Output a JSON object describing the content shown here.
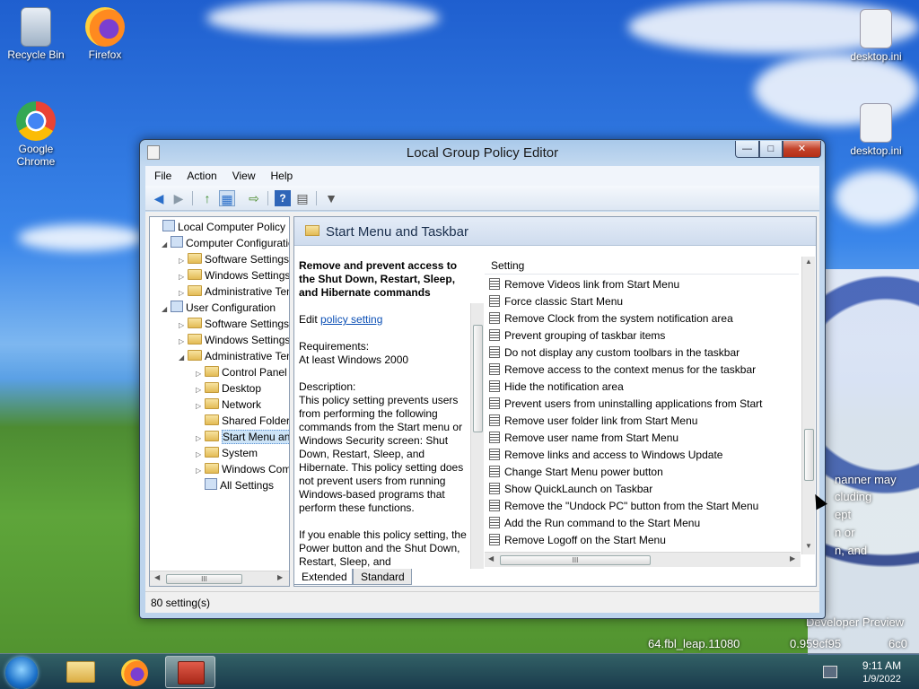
{
  "desktop": {
    "icons": [
      {
        "label": "Recycle Bin",
        "icon": "recycle-bin-icon"
      },
      {
        "label": "Firefox",
        "icon": "firefox-icon"
      },
      {
        "label": "Google Chrome",
        "icon": "chrome-icon"
      },
      {
        "label": "desktop.ini",
        "icon": "ini-file-icon"
      },
      {
        "label": "desktop.ini",
        "icon": "ini-file-icon"
      }
    ],
    "bg_fragments": [
      "nanner may",
      "cluding",
      "ept",
      "n or",
      "n, and",
      "Developer Preview",
      "64.fbl_leap.11080",
      "0.959cf95",
      "6c0"
    ]
  },
  "window": {
    "title": "Local Group Policy Editor",
    "controls": {
      "minimize": "—",
      "maximize": "□",
      "close": "✕"
    }
  },
  "menu": [
    "File",
    "Action",
    "View",
    "Help"
  ],
  "toolbar": {
    "icons": [
      "back-arrow-icon",
      "forward-arrow-icon",
      "up-folder-icon",
      "show-hide-tree-icon",
      "export-list-icon",
      "help-icon",
      "properties-icon",
      "filter-icon"
    ],
    "glyphs": {
      "back": "◀",
      "forward": "▶",
      "up": "↑",
      "tree": "▦",
      "export": "⇨",
      "help": "?",
      "props": "▤",
      "filter": "▼"
    }
  },
  "tree": {
    "items": [
      {
        "label": "Local Computer Policy",
        "level": 0,
        "exp": "",
        "type": "policy"
      },
      {
        "label": "Computer Configuration",
        "level": 1,
        "exp": "◢",
        "type": "pc"
      },
      {
        "label": "Software Settings",
        "level": 2,
        "exp": "▷",
        "type": "folder"
      },
      {
        "label": "Windows Settings",
        "level": 2,
        "exp": "▷",
        "type": "folder"
      },
      {
        "label": "Administrative Templates",
        "level": 2,
        "exp": "▷",
        "type": "folder"
      },
      {
        "label": "User Configuration",
        "level": 1,
        "exp": "◢",
        "type": "user"
      },
      {
        "label": "Software Settings",
        "level": 2,
        "exp": "▷",
        "type": "folder"
      },
      {
        "label": "Windows Settings",
        "level": 2,
        "exp": "▷",
        "type": "folder"
      },
      {
        "label": "Administrative Templates",
        "level": 2,
        "exp": "◢",
        "type": "folder"
      },
      {
        "label": "Control Panel",
        "level": 3,
        "exp": "▷",
        "type": "folder"
      },
      {
        "label": "Desktop",
        "level": 3,
        "exp": "▷",
        "type": "folder"
      },
      {
        "label": "Network",
        "level": 3,
        "exp": "▷",
        "type": "folder"
      },
      {
        "label": "Shared Folders",
        "level": 3,
        "exp": "",
        "type": "folder"
      },
      {
        "label": "Start Menu and Taskbar",
        "level": 3,
        "exp": "▷",
        "type": "folder",
        "selected": true
      },
      {
        "label": "System",
        "level": 3,
        "exp": "▷",
        "type": "folder"
      },
      {
        "label": "Windows Components",
        "level": 3,
        "exp": "▷",
        "type": "folder"
      },
      {
        "label": "All Settings",
        "level": 3,
        "exp": "",
        "type": "settings"
      }
    ],
    "scroll_thumb": "III"
  },
  "details": {
    "header": "Start Menu and Taskbar",
    "policy_title": "Remove and prevent access to the Shut Down, Restart, Sleep, and Hibernate commands",
    "edit_prefix": "Edit",
    "edit_link": "policy setting",
    "requirements_label": "Requirements:",
    "requirements_value": "At least Windows 2000",
    "description_label": "Description:",
    "description": "This policy setting prevents users from performing the following commands from the Start menu or Windows Security screen: Shut Down, Restart, Sleep, and Hibernate. This policy setting does not prevent users from running Windows-based programs that perform these functions.",
    "description_2": "If you enable this policy setting, the Power button and the Shut Down, Restart, Sleep, and",
    "column_header": "Setting",
    "settings": [
      "Remove Videos link from Start Menu",
      "Force classic Start Menu",
      "Remove Clock from the system notification area",
      "Prevent grouping of taskbar items",
      "Do not display any custom toolbars in the taskbar",
      "Remove access to the context menus for the taskbar",
      "Hide the notification area",
      "Prevent users from uninstalling applications from Start",
      "Remove user folder link from Start Menu",
      "Remove user name from Start Menu",
      "Remove links and access to Windows Update",
      "Change Start Menu power button",
      "Show QuickLaunch on Taskbar",
      "Remove the \"Undock PC\" button from the Start Menu",
      "Add the Run command to the Start Menu",
      "Remove Logoff on the Start Menu"
    ],
    "tabs": [
      "Extended",
      "Standard"
    ],
    "scroll_thumb": "III"
  },
  "status": "80 setting(s)",
  "taskbar": {
    "time": "9:11 AM",
    "date": "1/9/2022",
    "buttons": [
      "start-orb-icon",
      "explorer-icon",
      "firefox-icon",
      "group-policy-icon"
    ]
  }
}
